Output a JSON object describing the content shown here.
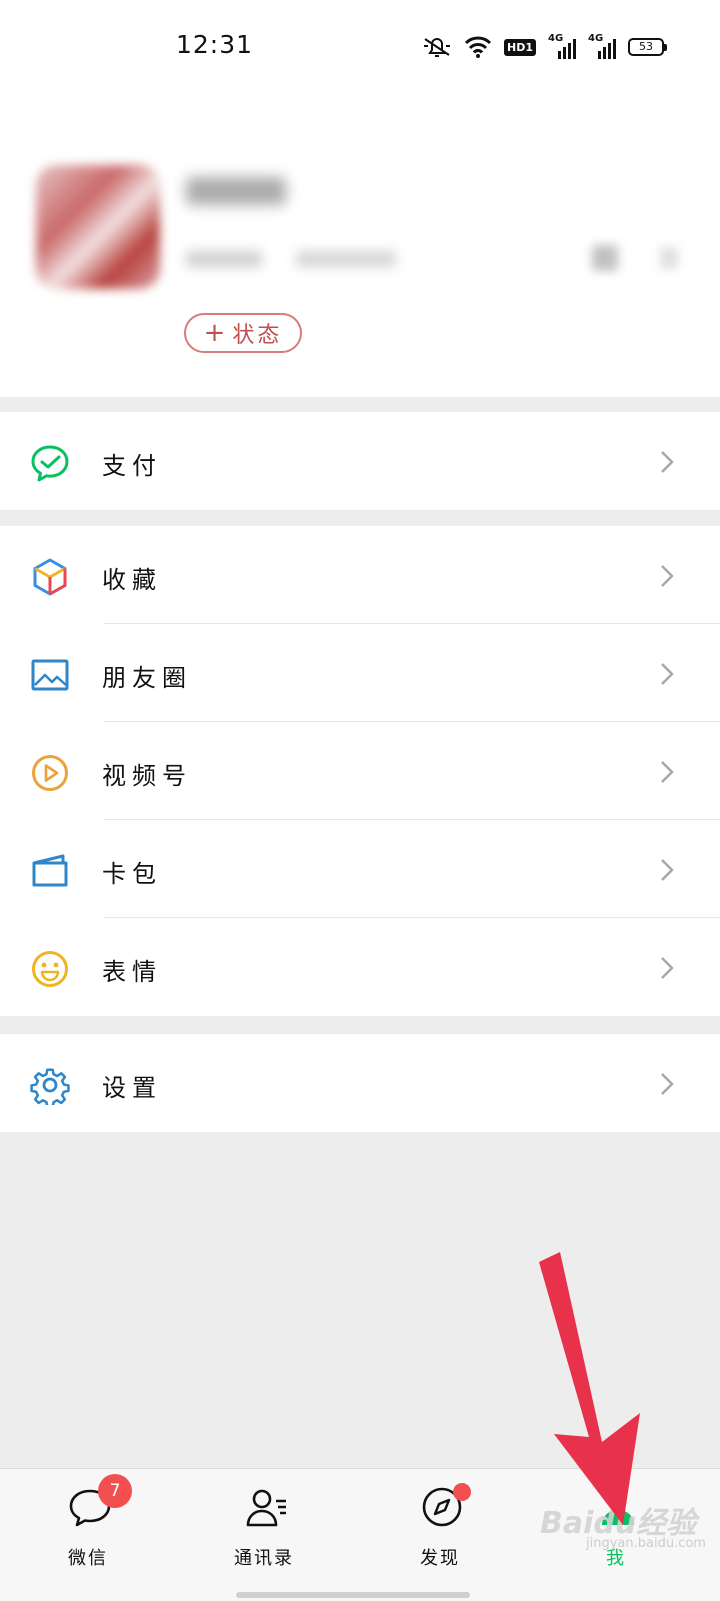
{
  "status_bar": {
    "time": "12:31",
    "network_1": "4G",
    "network_2": "4G",
    "hd": "HD",
    "battery": "53"
  },
  "profile": {
    "status_label": "状态"
  },
  "menu": {
    "pay": "支付",
    "favorites": "收藏",
    "moments": "朋友圈",
    "channels": "视频号",
    "cards": "卡包",
    "stickers": "表情",
    "settings": "设置"
  },
  "nav": {
    "chats": "微信",
    "chats_badge": "7",
    "contacts": "通讯录",
    "discover": "发现",
    "me": "我"
  },
  "watermark": {
    "text": "Baidu经验",
    "url": "jingyan.baidu.com"
  },
  "colors": {
    "green": "#07c160",
    "badge_red": "#f25050",
    "arrow_red": "#e8314b",
    "status_border": "#d77b7b"
  }
}
